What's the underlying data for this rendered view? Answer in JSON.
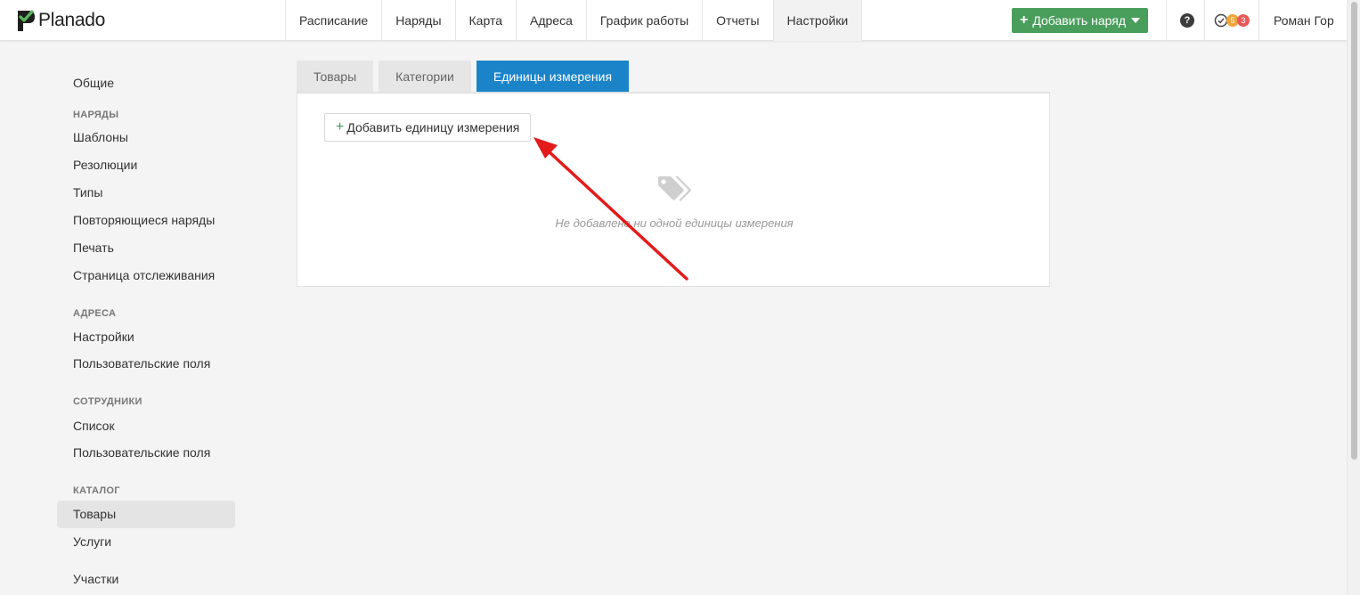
{
  "header": {
    "logo_text": "Planado",
    "nav": [
      "Расписание",
      "Наряды",
      "Карта",
      "Адреса",
      "График работы",
      "Отчеты",
      "Настройки"
    ],
    "active_nav": "Настройки",
    "add_order_label": "Добавить наряд",
    "help_label": "?",
    "badges": [
      "5",
      "3"
    ],
    "user_name": "Роман Гор"
  },
  "sidebar": {
    "general": "Общие",
    "sections": [
      {
        "title": "НАРЯДЫ",
        "items": [
          "Шаблоны",
          "Резолюции",
          "Типы",
          "Повторяющиеся наряды",
          "Печать",
          "Страница отслеживания"
        ]
      },
      {
        "title": "АДРЕСА",
        "items": [
          "Настройки",
          "Пользовательские поля"
        ]
      },
      {
        "title": "СОТРУДНИКИ",
        "items": [
          "Список",
          "Пользовательские поля"
        ]
      },
      {
        "title": "КАТАЛОГ",
        "items": [
          "Товары",
          "Услуги"
        ]
      }
    ],
    "active_item": "Товары",
    "last_item": "Участки"
  },
  "main": {
    "tabs": [
      "Товары",
      "Категории",
      "Единицы измерения"
    ],
    "active_tab": "Единицы измерения",
    "add_unit_label": "Добавить единицу измерения",
    "empty_text": "Не добавлено ни одной единицы измерения"
  },
  "colors": {
    "brand_green": "#4a9e5c",
    "tab_active": "#1b84c9",
    "annotation_arrow": "#e31b1b"
  }
}
